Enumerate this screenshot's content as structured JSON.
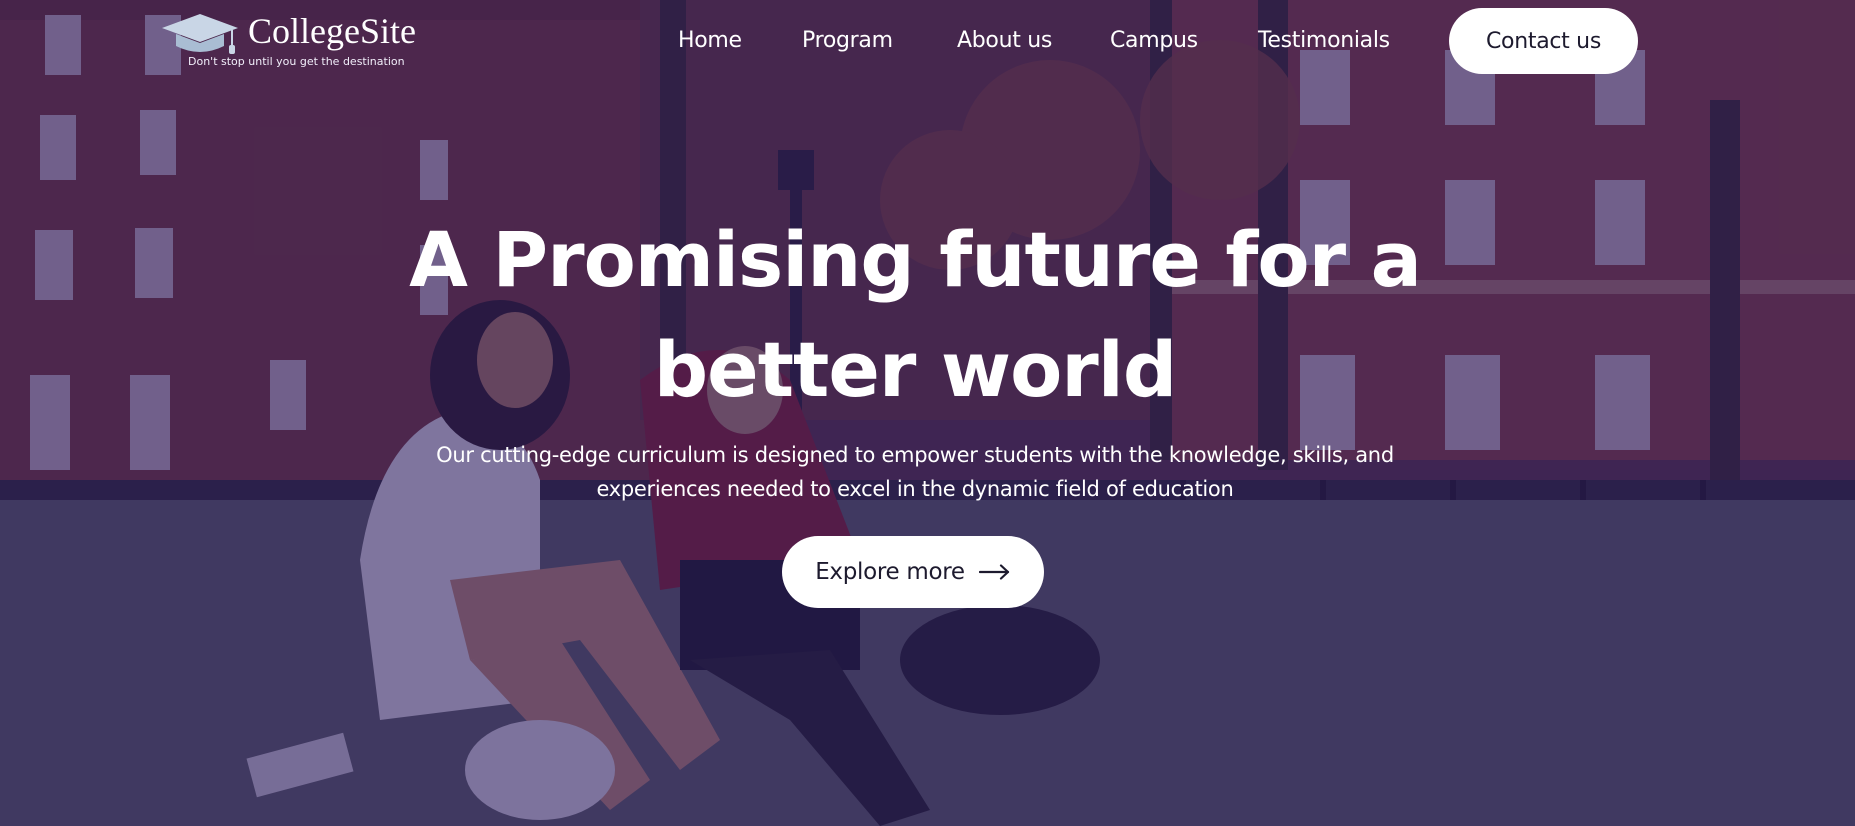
{
  "brand": {
    "name": "CollegeSite",
    "tagline": "Don't stop until you get the destination",
    "logo_icon": "graduation-cap-icon"
  },
  "nav": {
    "items": [
      {
        "label": "Home"
      },
      {
        "label": "Program"
      },
      {
        "label": "About us"
      },
      {
        "label": "Campus"
      },
      {
        "label": "Testimonials"
      }
    ],
    "contact_label": "Contact us"
  },
  "hero": {
    "headline_line1": "A Promising future for a",
    "headline_line2": "better world",
    "description": "Our cutting-edge curriculum is designed to empower students with the knowledge, skills, and experiences needed to excel in the dynamic field of education",
    "cta_label": "Explore more",
    "cta_icon": "arrow-right-icon"
  },
  "colors": {
    "overlay": "#28185c",
    "button_bg": "#ffffff",
    "button_text": "#1d1a2e",
    "text": "#ffffff"
  }
}
